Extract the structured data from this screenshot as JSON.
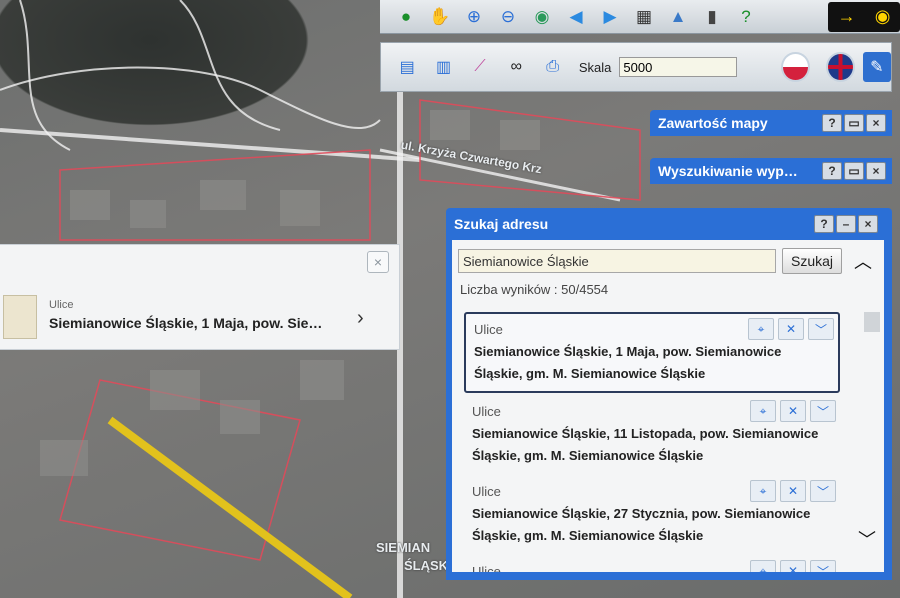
{
  "map": {
    "street_label_1": "SIEMIAN",
    "street_label_2": "ŚLĄSK",
    "street_top": "ul. Krzyża Czwartego Krz"
  },
  "toolbar": {
    "icons": [
      "info-icon",
      "hand-pan-icon",
      "zoom-in-icon",
      "zoom-out-icon",
      "globe-icon",
      "back-arrow-icon",
      "forward-arrow-icon",
      "grid-icon",
      "measure-icon",
      "file-icon",
      "help-icon",
      "arrow-eye-icon"
    ],
    "scale_label": "Skala",
    "scale_value": "5000"
  },
  "panels": {
    "map_content": "Zawartość mapy",
    "search_panel": "Wyszukiwanie wyp…"
  },
  "window_buttons": {
    "help": "?",
    "minimize": "–",
    "close": "×"
  },
  "search": {
    "title": "Szukaj adresu",
    "input_value": "Siemianowice Śląskie",
    "button_label": "Szukaj",
    "results_count": "Liczba wyników : 50/4554",
    "results": [
      {
        "category": "Ulice",
        "text_line1": "Siemianowice Śląskie, 1 Maja, pow. Siemianowice",
        "text_line2": "Śląskie, gm. M. Siemianowice Śląskie"
      },
      {
        "category": "Ulice",
        "text_line1": "Siemianowice Śląskie, 11 Listopada, pow. Siemianowice",
        "text_line2": "Śląskie, gm. M. Siemianowice Śląskie"
      },
      {
        "category": "Ulice",
        "text_line1": "Siemianowice Śląskie, 27 Stycznia, pow. Siemianowice",
        "text_line2": "Śląskie, gm. M. Siemianowice Śląskie"
      },
      {
        "category": "Ulice"
      }
    ]
  },
  "popup": {
    "close": "×",
    "category": "Ulice",
    "text": "Siemianowice Śląskie, 1 Maja, pow. Sie…",
    "chevron": "›"
  }
}
